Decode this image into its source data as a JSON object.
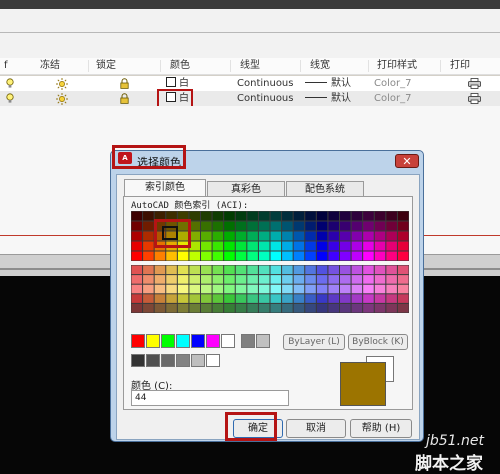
{
  "menubar": {
    "items": [
      "",
      "",
      "",
      "",
      "",
      "",
      "",
      ""
    ]
  },
  "layer_table": {
    "headers": [
      "冻结",
      "锁定",
      "颜色",
      "线型",
      "线宽",
      "打印样式",
      "打印"
    ],
    "rows": [
      {
        "color": "白",
        "linetype": "Continuous",
        "lineweight": "默认",
        "plot_style": "Color_7"
      },
      {
        "color": "白",
        "linetype": "Continuous",
        "lineweight": "默认",
        "plot_style": "Color_7"
      }
    ]
  },
  "dialog": {
    "title": "选择颜色",
    "close_label": "✕",
    "app_icon_label": "A",
    "tabs": [
      "索引颜色",
      "真彩色",
      "配色系统"
    ],
    "active_tab": "索引颜色",
    "aci_label": "AutoCAD 颜色索引 (ACI):",
    "bylayer_label": "ByLayer (L)",
    "byblock_label": "ByBlock (K)",
    "color_label": "颜色 (C):",
    "color_value": "44",
    "ok_label": "确定",
    "cancel_label": "取消",
    "help_label": "帮助 (H)"
  },
  "colors": {
    "selected": "#9c7400",
    "previous": "#ffffff",
    "highlight": "#b51414",
    "standard": [
      "#ff0000",
      "#ffff00",
      "#00ff00",
      "#00ffff",
      "#0000ff",
      "#ff00ff",
      "#ffffff",
      "#808080",
      "#c0c0c0"
    ],
    "grays": [
      "#333333",
      "#505050",
      "#696969",
      "#828282",
      "#bebebe",
      "#ffffff"
    ]
  },
  "watermark": {
    "line1": "jb51.net",
    "line2": "脚本之家"
  }
}
